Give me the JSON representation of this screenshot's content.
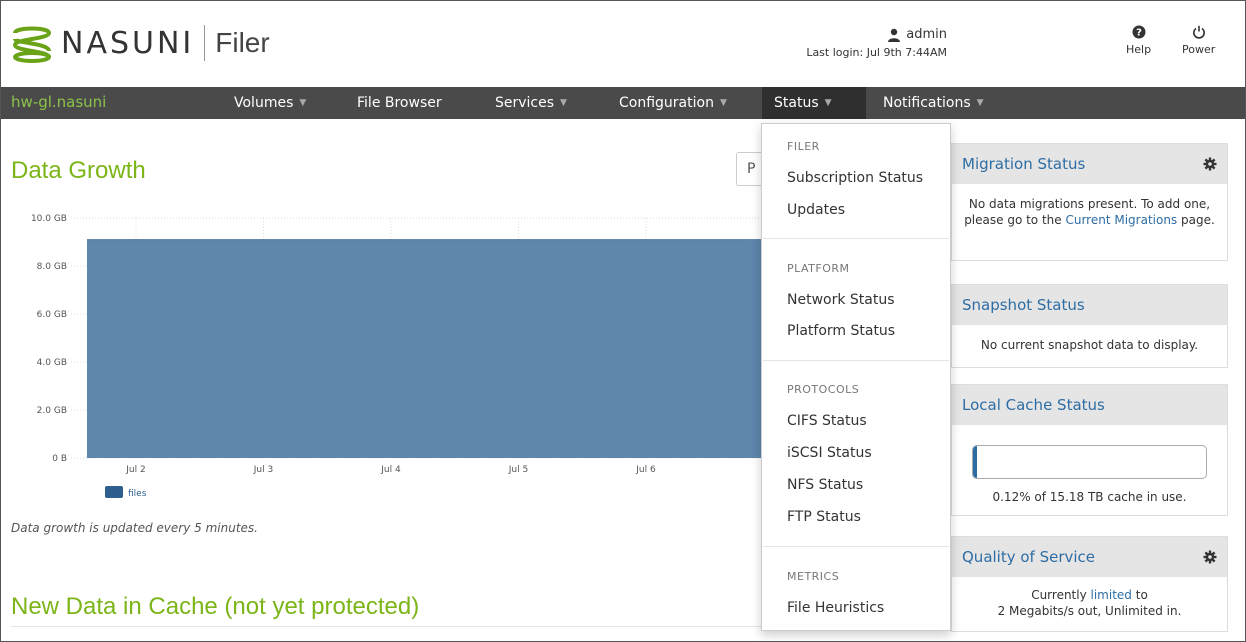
{
  "header": {
    "brand": "NASUNI",
    "product": "Filer",
    "user": "admin",
    "last_login": "Last login: Jul 9th 7:44AM",
    "help_label": "Help",
    "power_label": "Power"
  },
  "navbar": {
    "hostname": "hw-gl.nasuni",
    "items": [
      {
        "label": "Volumes",
        "has_caret": true
      },
      {
        "label": "File Browser",
        "has_caret": false
      },
      {
        "label": "Services",
        "has_caret": true
      },
      {
        "label": "Configuration",
        "has_caret": true
      },
      {
        "label": "Status",
        "has_caret": true,
        "active": true
      },
      {
        "label": "Notifications",
        "has_caret": true
      }
    ]
  },
  "main": {
    "data_growth_title": "Data Growth",
    "period_select_value": "P",
    "growth_note": "Data growth is updated every 5 minutes.",
    "new_data_title": "New Data in Cache (not yet protected)"
  },
  "chart_data": {
    "type": "area",
    "x": [
      "Jul 2",
      "Jul 3",
      "Jul 4",
      "Jul 5",
      "Jul 6",
      "J"
    ],
    "series": [
      {
        "name": "files",
        "values": [
          9.1,
          9.1,
          9.1,
          9.1,
          9.1,
          9.1
        ],
        "color": "#2e5f8f"
      }
    ],
    "y_ticks": [
      "0 B",
      "2.0 GB",
      "4.0 GB",
      "6.0 GB",
      "8.0 GB",
      "10.0 GB"
    ],
    "ylim": [
      0,
      10
    ],
    "ylabel_unit": "GB",
    "grid": true,
    "legend": "bottom-left"
  },
  "status_menu": {
    "sections": [
      {
        "header": "FILER",
        "items": [
          "Subscription Status",
          "Updates"
        ]
      },
      {
        "header": "PLATFORM",
        "items": [
          "Network Status",
          "Platform Status"
        ]
      },
      {
        "header": "PROTOCOLS",
        "items": [
          "CIFS Status",
          "iSCSI Status",
          "NFS Status",
          "FTP Status"
        ]
      },
      {
        "header": "METRICS",
        "items": [
          "File Heuristics"
        ]
      }
    ]
  },
  "panels": {
    "migration": {
      "title": "Migration Status",
      "text_before": "No data migrations present. To add one, please go to the ",
      "link": "Current Migrations",
      "text_after": " page."
    },
    "snapshot": {
      "title": "Snapshot Status",
      "text": "No current snapshot data to display."
    },
    "cache": {
      "title": "Local Cache Status",
      "percent_used": 0.12,
      "text": "0.12% of 15.18 TB cache in use."
    },
    "qos": {
      "title": "Quality of Service",
      "text_before": "Currently ",
      "link": "limited",
      "text_after": " to",
      "line2": "2 Megabits/s out, Unlimited in."
    }
  },
  "colors": {
    "accent_green": "#7cb518",
    "link_blue": "#2e6da4",
    "navbar_bg": "#4a4a4a",
    "series_fill": "#5f86ab"
  }
}
